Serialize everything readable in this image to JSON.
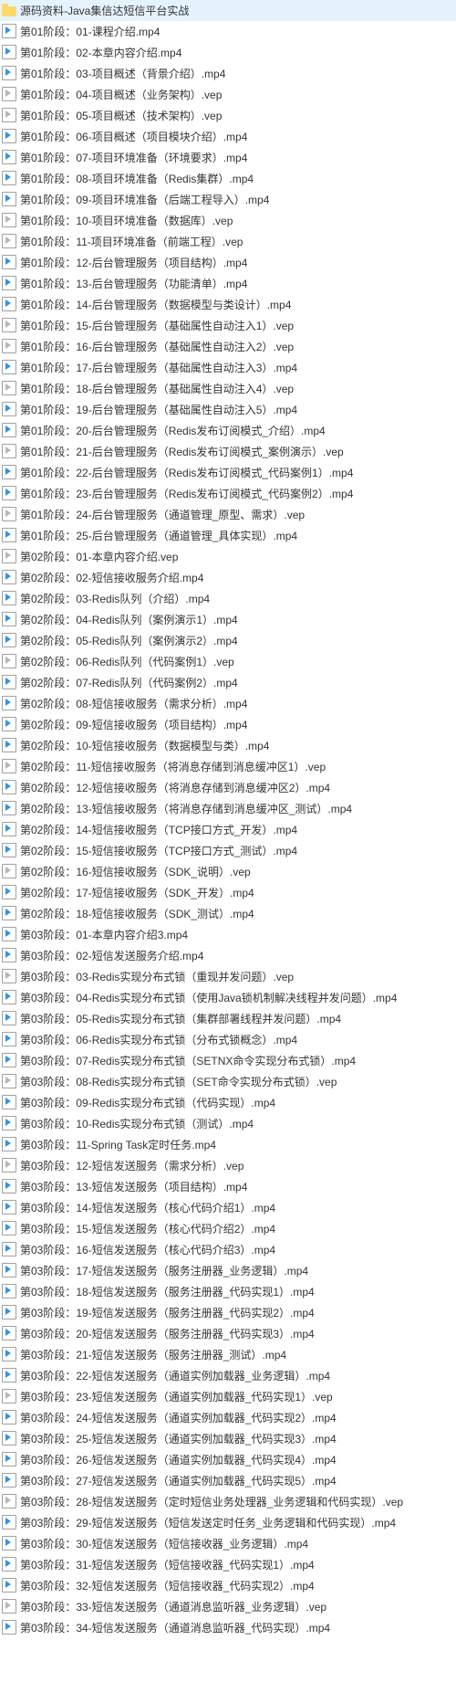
{
  "folder": "源码资料-Java集信达短信平台实战",
  "files": [
    {
      "name": "第01阶段：01-课程介绍.mp4",
      "t": "mp4"
    },
    {
      "name": "第01阶段：02-本章内容介绍.mp4",
      "t": "mp4"
    },
    {
      "name": "第01阶段：03-项目概述（背景介绍）.mp4",
      "t": "mp4"
    },
    {
      "name": "第01阶段：04-项目概述（业务架构）.vep",
      "t": "vep"
    },
    {
      "name": "第01阶段：05-项目概述（技术架构）.vep",
      "t": "vep"
    },
    {
      "name": "第01阶段：06-项目概述（项目模块介绍）.mp4",
      "t": "mp4"
    },
    {
      "name": "第01阶段：07-项目环境准备（环境要求）.mp4",
      "t": "mp4"
    },
    {
      "name": "第01阶段：08-项目环境准备（Redis集群）.mp4",
      "t": "mp4"
    },
    {
      "name": "第01阶段：09-项目环境准备（后端工程导入）.mp4",
      "t": "mp4"
    },
    {
      "name": "第01阶段：10-项目环境准备（数据库）.vep",
      "t": "vep"
    },
    {
      "name": "第01阶段：11-项目环境准备（前端工程）.vep",
      "t": "vep"
    },
    {
      "name": "第01阶段：12-后台管理服务（项目结构）.mp4",
      "t": "mp4"
    },
    {
      "name": "第01阶段：13-后台管理服务（功能清单）.mp4",
      "t": "mp4"
    },
    {
      "name": "第01阶段：14-后台管理服务（数据模型与类设计）.mp4",
      "t": "mp4"
    },
    {
      "name": "第01阶段：15-后台管理服务（基础属性自动注入1）.vep",
      "t": "vep"
    },
    {
      "name": "第01阶段：16-后台管理服务（基础属性自动注入2）.vep",
      "t": "vep"
    },
    {
      "name": "第01阶段：17-后台管理服务（基础属性自动注入3）.mp4",
      "t": "mp4"
    },
    {
      "name": "第01阶段：18-后台管理服务（基础属性自动注入4）.vep",
      "t": "vep"
    },
    {
      "name": "第01阶段：19-后台管理服务（基础属性自动注入5）.mp4",
      "t": "mp4"
    },
    {
      "name": "第01阶段：20-后台管理服务（Redis发布订阅模式_介绍）.mp4",
      "t": "mp4"
    },
    {
      "name": "第01阶段：21-后台管理服务（Redis发布订阅模式_案例演示）.vep",
      "t": "vep"
    },
    {
      "name": "第01阶段：22-后台管理服务（Redis发布订阅模式_代码案例1）.mp4",
      "t": "mp4"
    },
    {
      "name": "第01阶段：23-后台管理服务（Redis发布订阅模式_代码案例2）.mp4",
      "t": "mp4"
    },
    {
      "name": "第01阶段：24-后台管理服务（通道管理_原型、需求）.vep",
      "t": "vep"
    },
    {
      "name": "第01阶段：25-后台管理服务（通道管理_具体实现）.mp4",
      "t": "mp4"
    },
    {
      "name": "第02阶段：01-本章内容介绍.vep",
      "t": "vep"
    },
    {
      "name": "第02阶段：02-短信接收服务介绍.mp4",
      "t": "mp4"
    },
    {
      "name": "第02阶段：03-Redis队列（介绍）.mp4",
      "t": "mp4"
    },
    {
      "name": "第02阶段：04-Redis队列（案例演示1）.mp4",
      "t": "mp4"
    },
    {
      "name": "第02阶段：05-Redis队列（案例演示2）.mp4",
      "t": "mp4"
    },
    {
      "name": "第02阶段：06-Redis队列（代码案例1）.vep",
      "t": "vep"
    },
    {
      "name": "第02阶段：07-Redis队列（代码案例2）.mp4",
      "t": "mp4"
    },
    {
      "name": "第02阶段：08-短信接收服务（需求分析）.mp4",
      "t": "mp4"
    },
    {
      "name": "第02阶段：09-短信接收服务（项目结构）.mp4",
      "t": "mp4"
    },
    {
      "name": "第02阶段：10-短信接收服务（数据模型与类）.mp4",
      "t": "mp4"
    },
    {
      "name": "第02阶段：11-短信接收服务（将消息存储到消息缓冲区1）.vep",
      "t": "vep"
    },
    {
      "name": "第02阶段：12-短信接收服务（将消息存储到消息缓冲区2）.mp4",
      "t": "mp4"
    },
    {
      "name": "第02阶段：13-短信接收服务（将消息存储到消息缓冲区_测试）.mp4",
      "t": "mp4"
    },
    {
      "name": "第02阶段：14-短信接收服务（TCP接口方式_开发）.mp4",
      "t": "mp4"
    },
    {
      "name": "第02阶段：15-短信接收服务（TCP接口方式_测试）.mp4",
      "t": "mp4"
    },
    {
      "name": "第02阶段：16-短信接收服务（SDK_说明）.vep",
      "t": "vep"
    },
    {
      "name": "第02阶段：17-短信接收服务（SDK_开发）.mp4",
      "t": "mp4"
    },
    {
      "name": "第02阶段：18-短信接收服务（SDK_测试）.mp4",
      "t": "mp4"
    },
    {
      "name": "第03阶段：01-本章内容介绍3.mp4",
      "t": "mp4"
    },
    {
      "name": "第03阶段：02-短信发送服务介绍.mp4",
      "t": "mp4"
    },
    {
      "name": "第03阶段：03-Redis实现分布式锁（重现并发问题）.vep",
      "t": "vep"
    },
    {
      "name": "第03阶段：04-Redis实现分布式锁（使用Java锁机制解决线程并发问题）.mp4",
      "t": "mp4"
    },
    {
      "name": "第03阶段：05-Redis实现分布式锁（集群部署线程并发问题）.mp4",
      "t": "mp4"
    },
    {
      "name": "第03阶段：06-Redis实现分布式锁（分布式锁概念）.mp4",
      "t": "mp4"
    },
    {
      "name": "第03阶段：07-Redis实现分布式锁（SETNX命令实现分布式锁）.mp4",
      "t": "mp4"
    },
    {
      "name": "第03阶段：08-Redis实现分布式锁（SET命令实现分布式锁）.vep",
      "t": "vep"
    },
    {
      "name": "第03阶段：09-Redis实现分布式锁（代码实现）.mp4",
      "t": "mp4"
    },
    {
      "name": "第03阶段：10-Redis实现分布式锁（测试）.mp4",
      "t": "mp4"
    },
    {
      "name": "第03阶段：11-Spring Task定时任务.mp4",
      "t": "mp4"
    },
    {
      "name": "第03阶段：12-短信发送服务（需求分析）.vep",
      "t": "vep"
    },
    {
      "name": "第03阶段：13-短信发送服务（项目结构）.mp4",
      "t": "mp4"
    },
    {
      "name": "第03阶段：14-短信发送服务（核心代码介绍1）.mp4",
      "t": "mp4"
    },
    {
      "name": "第03阶段：15-短信发送服务（核心代码介绍2）.mp4",
      "t": "mp4"
    },
    {
      "name": "第03阶段：16-短信发送服务（核心代码介绍3）.mp4",
      "t": "mp4"
    },
    {
      "name": "第03阶段：17-短信发送服务（服务注册器_业务逻辑）.mp4",
      "t": "mp4"
    },
    {
      "name": "第03阶段：18-短信发送服务（服务注册器_代码实现1）.mp4",
      "t": "mp4"
    },
    {
      "name": "第03阶段：19-短信发送服务（服务注册器_代码实现2）.mp4",
      "t": "mp4"
    },
    {
      "name": "第03阶段：20-短信发送服务（服务注册器_代码实现3）.mp4",
      "t": "mp4"
    },
    {
      "name": "第03阶段：21-短信发送服务（服务注册器_测试）.mp4",
      "t": "mp4"
    },
    {
      "name": "第03阶段：22-短信发送服务（通道实例加载器_业务逻辑）.mp4",
      "t": "mp4"
    },
    {
      "name": "第03阶段：23-短信发送服务（通道实例加载器_代码实现1）.vep",
      "t": "vep"
    },
    {
      "name": "第03阶段：24-短信发送服务（通道实例加载器_代码实现2）.mp4",
      "t": "mp4"
    },
    {
      "name": "第03阶段：25-短信发送服务（通道实例加载器_代码实现3）.mp4",
      "t": "mp4"
    },
    {
      "name": "第03阶段：26-短信发送服务（通道实例加载器_代码实现4）.mp4",
      "t": "mp4"
    },
    {
      "name": "第03阶段：27-短信发送服务（通道实例加载器_代码实现5）.mp4",
      "t": "mp4"
    },
    {
      "name": "第03阶段：28-短信发送服务（定时短信业务处理器_业务逻辑和代码实现）.vep",
      "t": "vep"
    },
    {
      "name": "第03阶段：29-短信发送服务（短信发送定时任务_业务逻辑和代码实现）.mp4",
      "t": "mp4"
    },
    {
      "name": "第03阶段：30-短信发送服务（短信接收器_业务逻辑）.mp4",
      "t": "mp4"
    },
    {
      "name": "第03阶段：31-短信发送服务（短信接收器_代码实现1）.mp4",
      "t": "mp4"
    },
    {
      "name": "第03阶段：32-短信发送服务（短信接收器_代码实现2）.mp4",
      "t": "mp4"
    },
    {
      "name": "第03阶段：33-短信发送服务（通道消息监听器_业务逻辑）.vep",
      "t": "vep"
    },
    {
      "name": "第03阶段：34-短信发送服务（通道消息监听器_代码实现）.mp4",
      "t": "mp4"
    }
  ]
}
